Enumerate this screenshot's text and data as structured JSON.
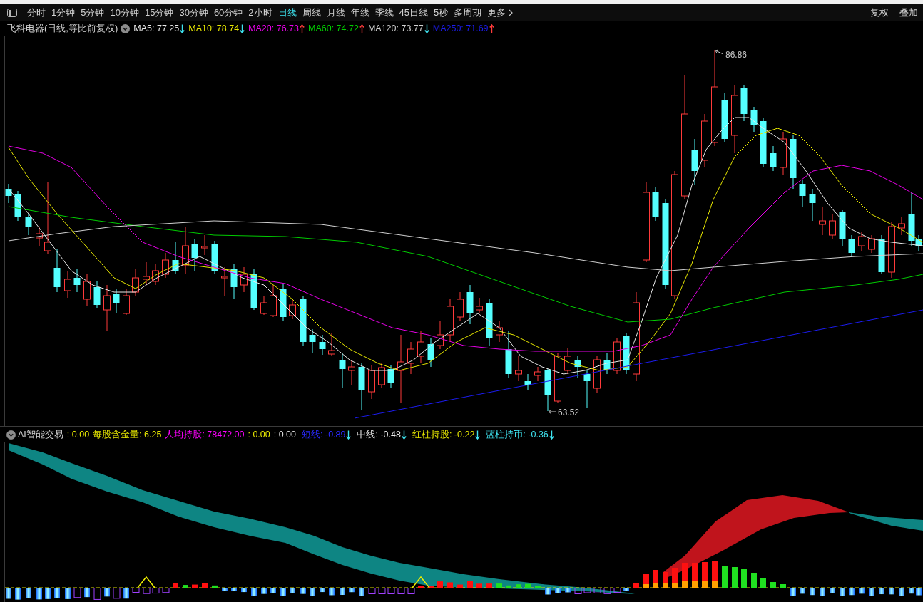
{
  "toolbar": {
    "periods": [
      {
        "label": "分时",
        "selected": false
      },
      {
        "label": "1分钟",
        "selected": false
      },
      {
        "label": "5分钟",
        "selected": false
      },
      {
        "label": "10分钟",
        "selected": false
      },
      {
        "label": "15分钟",
        "selected": false
      },
      {
        "label": "30分钟",
        "selected": false
      },
      {
        "label": "60分钟",
        "selected": false
      },
      {
        "label": "2小时",
        "selected": false
      },
      {
        "label": "日线",
        "selected": true
      },
      {
        "label": "周线",
        "selected": false
      },
      {
        "label": "月线",
        "selected": false
      },
      {
        "label": "年线",
        "selected": false
      },
      {
        "label": "季线",
        "selected": false
      },
      {
        "label": "45日线",
        "selected": false
      },
      {
        "label": "5秒",
        "selected": false
      },
      {
        "label": "多周期",
        "selected": false
      }
    ],
    "more": {
      "label": "更多"
    },
    "actions": [
      {
        "label": "复权"
      },
      {
        "label": "叠加"
      }
    ]
  },
  "price_chart": {
    "title": "飞科电器(日线,等比前复权)",
    "moving_averages": [
      {
        "label": "MA5: 77.25",
        "color": "#e8e8e8",
        "rising": false
      },
      {
        "label": "MA10: 78.74",
        "color": "#e6e600",
        "rising": false
      },
      {
        "label": "MA20: 76.73",
        "color": "#e600e6",
        "rising": true
      },
      {
        "label": "MA60: 74.72",
        "color": "#00cc00",
        "rising": true
      },
      {
        "label": "MA120: 73.77",
        "color": "#d0d0d0",
        "rising": false
      },
      {
        "label": "MA250: 71.69",
        "color": "#1c1cf0",
        "rising": true
      }
    ],
    "price_marks": [
      {
        "kind": "high",
        "label": "86.86"
      },
      {
        "kind": "low",
        "label": "63.52"
      }
    ]
  },
  "indicator": {
    "title": "AI智能交易",
    "readings": [
      {
        "kind": "value",
        "label": ": 0.00",
        "color": "#e6e600"
      },
      {
        "kind": "value",
        "label": "每股含金量: 6.25",
        "color": "#e6e600"
      },
      {
        "kind": "value",
        "label": "人均持股: 78472.00",
        "color": "#ff00ff"
      },
      {
        "kind": "value",
        "label": ": 0.00",
        "color": "#e6e600"
      },
      {
        "kind": "value",
        "label": ": 0.00",
        "color": "#d8d8d8"
      },
      {
        "kind": "trend",
        "label": "短线: -0.89",
        "color": "#2a2aff",
        "rising": false
      },
      {
        "kind": "trend",
        "label": "中线: -0.48",
        "color": "#e8e8e8",
        "rising": false
      },
      {
        "kind": "trend",
        "label": "红柱持股: -0.22",
        "color": "#e6e600",
        "rising": false
      },
      {
        "kind": "trend",
        "label": "蓝柱持币: -0.36",
        "color": "#3fe3f0",
        "rising": false
      }
    ]
  }
}
